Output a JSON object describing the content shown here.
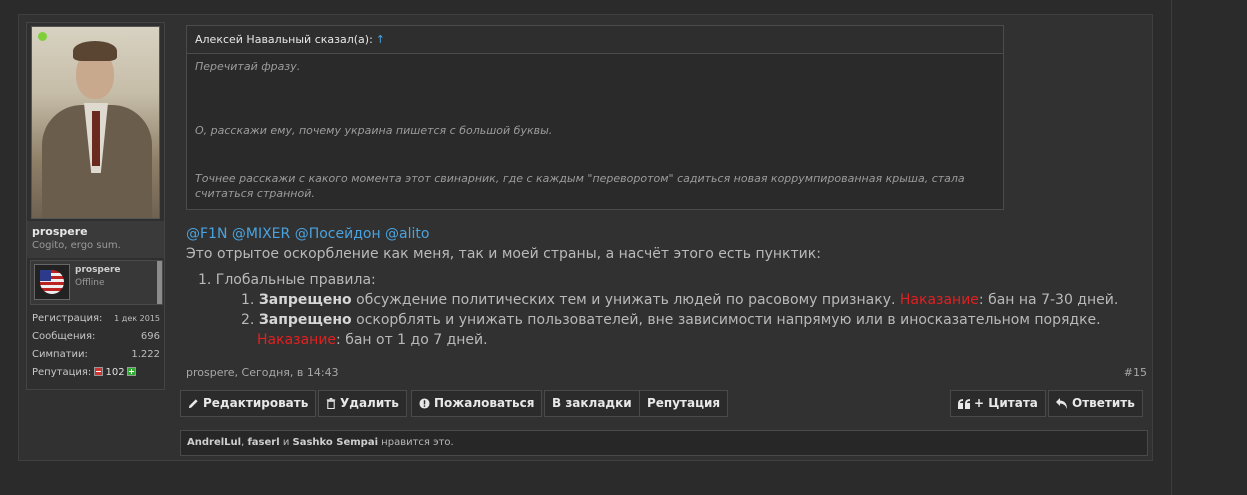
{
  "user": {
    "username": "prospere",
    "title": "Cogito, ergo sum.",
    "mini_name": "prospere",
    "mini_status": "Offline",
    "stats": [
      {
        "label": "Регистрация:",
        "value": "1 дек 2015"
      },
      {
        "label": "Сообщения:",
        "value": "696"
      },
      {
        "label": "Симпатии:",
        "value": "1.222"
      }
    ],
    "reputation_label": "Репутация:",
    "reputation_value": "102"
  },
  "quote": {
    "author_line": "Алексей Навальный сказал(а):",
    "arrow": "↑",
    "paragraphs": [
      "Перечитай фразу.",
      "О, расскажи ему, почему украина пишется с большой буквы.",
      "Точнее расскажи с какого момента этот свинарник, где с каждым \"переворотом\" садиться новая коррумпированная крыша, стала считаться странной."
    ]
  },
  "message": {
    "mentions": "@F1N @MIXER @Посейдон @alito",
    "intro": "Это отрытое оскорбление как меня, так и моей страны, а насчёт этого есть пунктик:",
    "rule1": "1. Глобальные правила:",
    "rule1_1_num": "1. ",
    "rule1_1_strong": "Запрещено",
    "rule1_1_text": " обсуждение политических тем и унижать людей по расовому признаку. ",
    "rule1_1_penalty": "Наказание",
    "rule1_1_tail": ": бан на 7-30 дней.",
    "rule1_2_num": "2. ",
    "rule1_2_strong": "Запрещено",
    "rule1_2_text": " оскорблять и унижать пользователей, вне зависимости напрямую или в иносказательном порядке.",
    "rule1_2_penalty": "Наказание",
    "rule1_2_tail": ": бан от 1 до 7 дней."
  },
  "meta": {
    "author_time": "prospere, Сегодня, в 14:43",
    "post_number": "#15"
  },
  "actions": {
    "edit": "Редактировать",
    "delete": "Удалить",
    "report": "Пожаловаться",
    "bookmark": "В закладки",
    "reputation": "Репутация",
    "quote": "+ Цитата",
    "reply": "Ответить"
  },
  "likes": {
    "user1": "AndrelLul",
    "sep1": ", ",
    "user2": "faserl",
    "sep2": " и ",
    "user3": "Sashko Sempai",
    "suffix": " нравится это."
  },
  "colors": {
    "link": "#4aa3df",
    "penalty": "#e02020",
    "online": "#7fcf3a"
  }
}
